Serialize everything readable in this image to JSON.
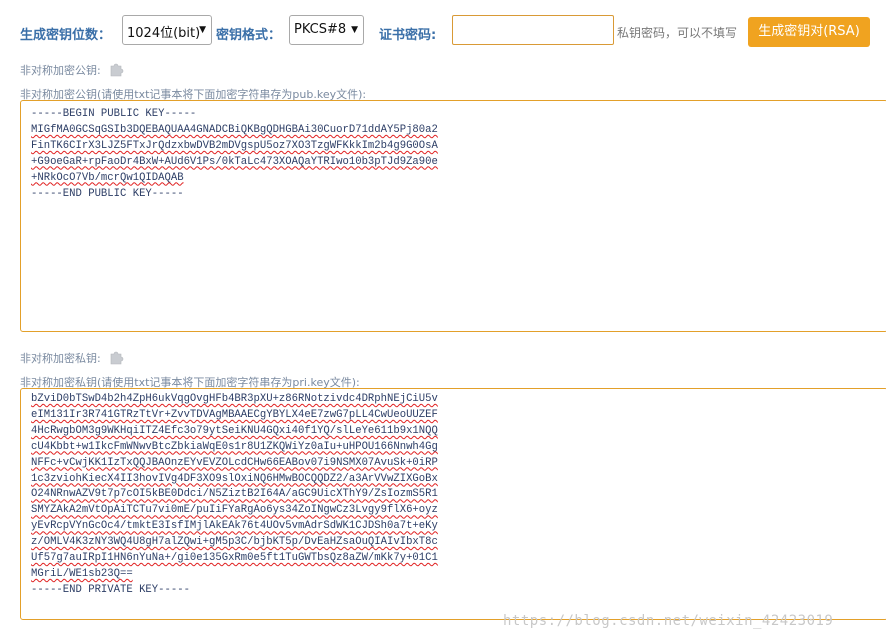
{
  "toolbar": {
    "key_bits_label": "生成密钥位数：",
    "key_bits_value": "1024位(bit)",
    "key_format_label": "密钥格式：",
    "key_format_value": "PKCS#8",
    "cert_password_label": "证书密码:",
    "cert_password_value": "",
    "cert_password_hint": "私钥密码，可以不填写",
    "generate_button": "生成密钥对(RSA)"
  },
  "public_key": {
    "label": "非对称加密公钥:",
    "sublabel": "非对称加密公钥(请使用txt记事本将下面加密字符串存为pub.key文件):",
    "lines": [
      "-----BEGIN PUBLIC KEY-----",
      "MIGfMA0GCSqGSIb3DQEBAQUAA4GNADCBiQKBgQDHGBAi30CuorD71ddAY5Pj80a2",
      "FinTK6CIrX3LJZ5FTxJrQdzxbwDVB2mDVgspU5oz7XO3TzgWFKkkIm2b4g9G0OsA",
      "+G9oeGaR+rpFaoDr4BxW+AUd6V1Ps/0kTaLc473XOAQaYTRIwo10b3pTJd9Za90e",
      "+NRkOcO7Vb/mcrQw1QIDAQAB",
      "-----END PUBLIC KEY-----"
    ]
  },
  "private_key": {
    "label": "非对称加密私钥:",
    "sublabel": "非对称加密私钥(请使用txt记事本将下面加密字符串存为pri.key文件):",
    "lines": [
      "bZviD0bTSwD4b2h4ZpH6ukVqgOvgHFb4BR3pXU+z86RNotzivdc4DRphNEjCiU5v",
      "eIM131Ir3R741GTRzTtVr+ZvvTDVAgMBAAECgYBYLX4eE7zwG7pLL4CwUeoUUZEF",
      "4HcRwgbOM3g9WKHqiITZ4Efc3o79ytSeiKNU4GQxi40f1YQ/slLeYe611b9x1NQQ",
      "cU4Kbbt+w1IkcFmWNwvBtcZbkiaWqE0s1r8U1ZKQWiYz0aIu+uHPOU166Nnwh4Gg",
      "NFFc+vCwjKK1IzTxQQJBAOnzEYvEVZOLcdCHw66EABov07i9NSMX07AvuSk+0iRP",
      "1c3zviohKiecX4II3hovIVg4DF3XO9slOxiNQ6HMwBOCQQDZ2/a3ArVVwZIXGoBx",
      "O24NRnwAZV9t7p7cOI5kBE0Ddci/N5ZiztB2I64A/aGC9UicXThY9/ZsIozmS5R1",
      "SMYZAkA2mVtOpAiTCTu7vi0mE/puIiFYaRgAo6ys34ZoINgwCz3Lvgy9flX6+oyz",
      "yEvRcpVYnGcOc4/tmktE3IsfIMjlAkEAk76t4UOv5vmAdrSdWK1CJDSh0a7t+eKy",
      "z/OMLV4K3zNY3WQ4U8gH7alZQwi+gM5p3C/bjbKT5p/DvEaHZsaOuQIAIvIbxT8c",
      "Uf57g7auIRpI1HN6nYuNa+/gi0e135GxRm0e5ft1TuGWTbsQz8aZW/mKk7y+01C1",
      "MGriL/WE1sb23Q==",
      "-----END PRIVATE KEY-----"
    ]
  },
  "watermark": "https://blog.csdn.net/weixin_42423019",
  "colors": {
    "accent": "#f0a320",
    "label": "#3a6fa8",
    "box_border": "#e3a02a"
  }
}
